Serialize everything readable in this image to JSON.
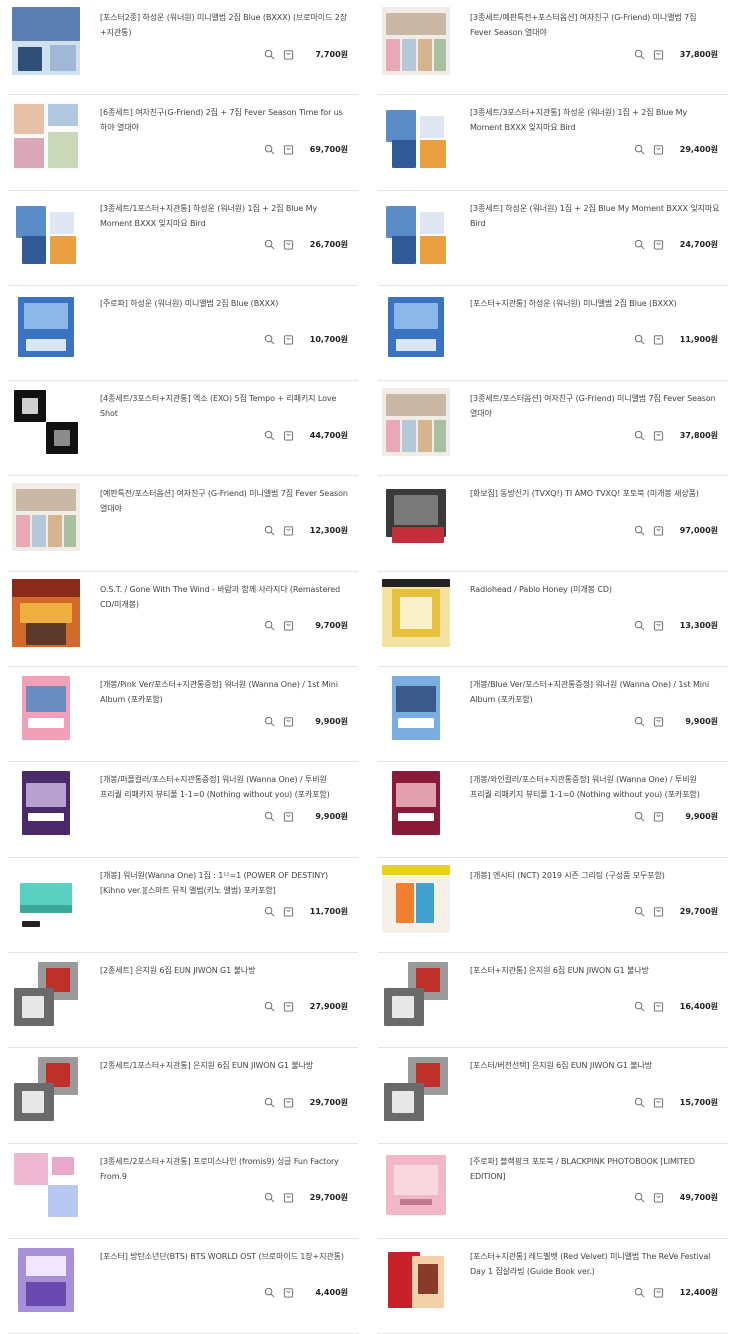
{
  "products": [
    {
      "title": "[포스터2종] 하성운 (워너원) 미니앨범 2집 Blue (BXXX) (브로마이드 2장+지관통)",
      "price": "7,700원",
      "thumb": "bxxx-poster"
    },
    {
      "title": "[3종세트/예판특전+포스터옵션] 여자친구 (G-Friend) 미니앨범 7집 Fever Season 열대야",
      "price": "37,800원",
      "thumb": "gfriend-set"
    },
    {
      "title": "[6종세트] 여자친구(G-Friend) 2집 + 7집 Fever Season Time for us 하야 열대야",
      "price": "69,700원",
      "thumb": "gfriend-6set"
    },
    {
      "title": "[3종세트/3포스터+지관통] 하성운 (워너원) 1집 + 2집 Blue My Moment BXXX 잊지마요 Bird",
      "price": "29,400원",
      "thumb": "hsw-3set"
    },
    {
      "title": "[3종세트/1포스터+지관통] 하성운 (워너원) 1집 + 2집 Blue My Moment BXXX 잊지마요 Bird",
      "price": "26,700원",
      "thumb": "hsw-3set"
    },
    {
      "title": "[3종세트] 하성운 (워너원) 1집 + 2집 Blue My Moment BXXX 잊지마요 Bird",
      "price": "24,700원",
      "thumb": "hsw-3set"
    },
    {
      "title": "[주로파] 하성운 (워너원) 미니앨범 2집 Blue (BXXX)",
      "price": "10,700원",
      "thumb": "hsw-blue"
    },
    {
      "title": "[포스터+지관통] 하성운 (워너원) 미니앨범 2집 Blue (BXXX)",
      "price": "11,900원",
      "thumb": "hsw-blue"
    },
    {
      "title": "[4종세트/3포스터+지관통] 엑소 (EXO) 5집 Tempo + 리패키지 Love Shot",
      "price": "44,700원",
      "thumb": "exo"
    },
    {
      "title": "[3종세트/포스터옵션] 여자친구 (G-Friend) 미니앨범 7집 Fever Season 열대야",
      "price": "37,800원",
      "thumb": "gfriend-set"
    },
    {
      "title": "[예판특전/포스터옵션] 여자친구 (G-Friend) 미니앨범 7집 Fever Season 열대야",
      "price": "12,300원",
      "thumb": "gfriend-set"
    },
    {
      "title": "[화보집] 동방신기 (TVXQ!) TI AMO TVXQ! 포토북 (미개봉 새상품)",
      "price": "97,000원",
      "thumb": "tvxq"
    },
    {
      "title": "O.S.T. / Gone With The Wind - 바람과 함께 사라지다 (Remastered CD/미개봉)",
      "price": "9,700원",
      "thumb": "gwtw"
    },
    {
      "title": "Radiohead / Pablo Honey (미개봉 CD)",
      "price": "13,300원",
      "thumb": "radiohead"
    },
    {
      "title": "[개봉/Pink Ver/포스터+지관통증정] 워너원 (Wanna One) / 1st Mini Album (포카포함)",
      "price": "9,900원",
      "thumb": "wo-pink"
    },
    {
      "title": "[개봉/Blue Ver/포스터+지관통증정] 워너원 (Wanna One) / 1st Mini Album (포카포함)",
      "price": "9,900원",
      "thumb": "wo-blue"
    },
    {
      "title": "[개봉/퍼플컬러/포스터+지관통증정] 워너원 (Wanna One) / 투비원 프리퀄 리패키지 뷰티풀 1-1=0 (Nothing without you) (포카포함)",
      "price": "9,900원",
      "thumb": "wo-purple"
    },
    {
      "title": "[개봉/와인컬러/포스터+지관통증정] 워너원 (Wanna One) / 투비원 프리퀄 리패키지 뷰티풀 1-1=0 (Nothing without you) (포카포함)",
      "price": "9,900원",
      "thumb": "wo-wine"
    },
    {
      "title": "[개봉] 워너원(Wanna One) 1집 : 1¹¹=1 (POWER OF DESTINY) [Kihno ver.][스마트 뮤직 앨범(키노 앨범) 포카포함]",
      "price": "11,700원",
      "thumb": "kihno"
    },
    {
      "title": "[개봉] 엔시티 (NCT) 2019 시즌 그리팅 (구성품 모두포함)",
      "price": "29,700원",
      "thumb": "nct"
    },
    {
      "title": "[2종세트] 은지원 6집 EUN JIWON G1 불나방",
      "price": "27,900원",
      "thumb": "g1"
    },
    {
      "title": "[포스터+지관통] 은지원 6집 EUN JIWON G1 불나방",
      "price": "16,400원",
      "thumb": "g1"
    },
    {
      "title": "[2종세트/1포스터+지관통] 은지원 6집 EUN JIWON G1 불나방",
      "price": "29,700원",
      "thumb": "g1"
    },
    {
      "title": "[포스터/버전선택] 은지원 6집 EUN JIWON G1 불나방",
      "price": "15,700원",
      "thumb": "g1"
    },
    {
      "title": "[3종세트/2포스터+지관통] 프로미스나인 (fromis9) 싱글 Fun Factory From.9",
      "price": "29,700원",
      "thumb": "fromis"
    },
    {
      "title": "[주로파] 블랙핑크 포토북 / BLACKPINK PHOTOBOOK [LIMITED EDITION]",
      "price": "49,700원",
      "thumb": "blackpink"
    },
    {
      "title": "[포스터] 방탄소년단(BTS) BTS WORLD OST (브로마이드 1장+지관통)",
      "price": "4,400원",
      "thumb": "bts"
    },
    {
      "title": "[포스터+지관통] 레드벨벳 (Red Velvet) 미니앨범 The ReVe Festival Day 1 집살라빔 (Guide Book ver.)",
      "price": "12,400원",
      "thumb": "redvelvet"
    }
  ],
  "icons": {
    "search": "search-icon",
    "cart": "cart-icon"
  }
}
